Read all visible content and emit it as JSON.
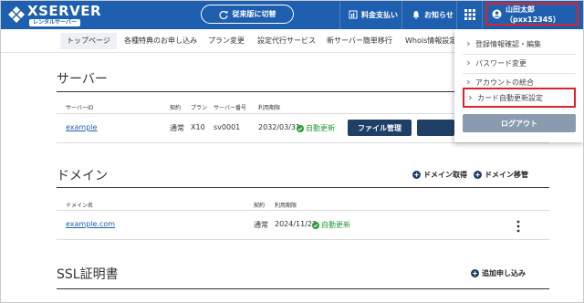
{
  "header": {
    "logo_text": "XSERVER",
    "logo_sub": "レンタルサーバー",
    "switch_label": "従来版に切替",
    "links": [
      "料金支払い",
      "お知らせ"
    ],
    "user_label": "山田太郎（pxx12345）"
  },
  "tabs": [
    "トップページ",
    "各種特典のお申し込み",
    "プラン変更",
    "設定代行サービス",
    "新サーバー簡単移行",
    "Whois情報設定"
  ],
  "server": {
    "title": "サーバー",
    "headers": [
      "サーバーID",
      "契約",
      "プラン",
      "サーバー番号",
      "利用期限"
    ],
    "row": {
      "id": "example",
      "contract": "通常",
      "plan": "X10",
      "number": "sv0001",
      "expiry": "2032/03/31",
      "status": "自動更新"
    },
    "file_manager_label": "ファイル管理"
  },
  "domain": {
    "title": "ドメイン",
    "actions": [
      "ドメイン取得",
      "ドメイン移管"
    ],
    "headers": [
      "ドメイン名",
      "契約",
      "利用期限"
    ],
    "row": {
      "name": "example.com",
      "contract": "通常",
      "expiry": "2024/11/23",
      "status": "自動更新"
    }
  },
  "ssl": {
    "title": "SSL証明書",
    "action": "追加申し込み"
  },
  "dropdown": {
    "items": [
      "登録情報確認・編集",
      "パスワード変更",
      "アカウントの統合",
      "カード自動更新設定"
    ],
    "logout_label": "ログアウト"
  },
  "colors": {
    "header_bg": "#1f5fb0",
    "highlight": "#e0202a",
    "status_green": "#2a9a3a",
    "dark_button": "#1f3f66"
  }
}
